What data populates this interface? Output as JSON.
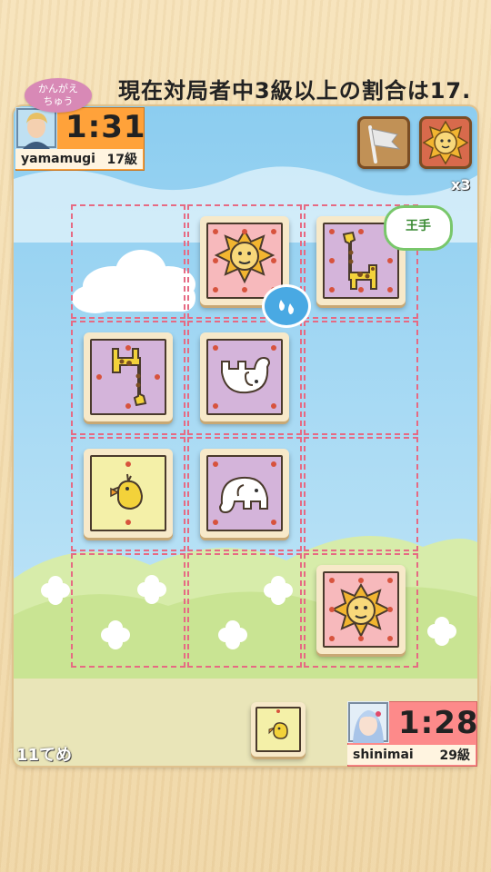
{
  "banner": {
    "text": "現在対局者中3級以上の割合は17."
  },
  "opponent": {
    "status": "かんがえ\nちゅう",
    "status_line1": "かんがえ",
    "status_line2": "ちゅう",
    "time": "1:31",
    "name": "yamamugi",
    "rank": "17級"
  },
  "player": {
    "time": "1:28",
    "name": "shinimai",
    "rank": "29級"
  },
  "buttons": {
    "resign_icon": "flag-icon",
    "captured_icon": "lion-icon",
    "captured_count": "x3"
  },
  "board_bubble": {
    "text": "王手"
  },
  "move_counter": "11てめ",
  "pieces": [
    {
      "animal": "lion",
      "owner": "opponent"
    },
    {
      "animal": "giraffe",
      "owner": "player"
    },
    {
      "animal": "giraffe",
      "owner": "opponent"
    },
    {
      "animal": "elephant",
      "owner": "opponent"
    },
    {
      "animal": "chick",
      "owner": "player"
    },
    {
      "animal": "elephant",
      "owner": "player"
    },
    {
      "animal": "lion",
      "owner": "player"
    }
  ],
  "hand_piece": {
    "animal": "chick"
  },
  "colors": {
    "lion_bg": "#f7b9bc",
    "giraffe_bg": "#d4b4da",
    "elephant_bg": "#d4b4da",
    "chick_bg": "#f4f0a8",
    "timer_opponent": "#ffa23a",
    "timer_player": "#fd8a8a",
    "cell_border": "#e66a83"
  }
}
